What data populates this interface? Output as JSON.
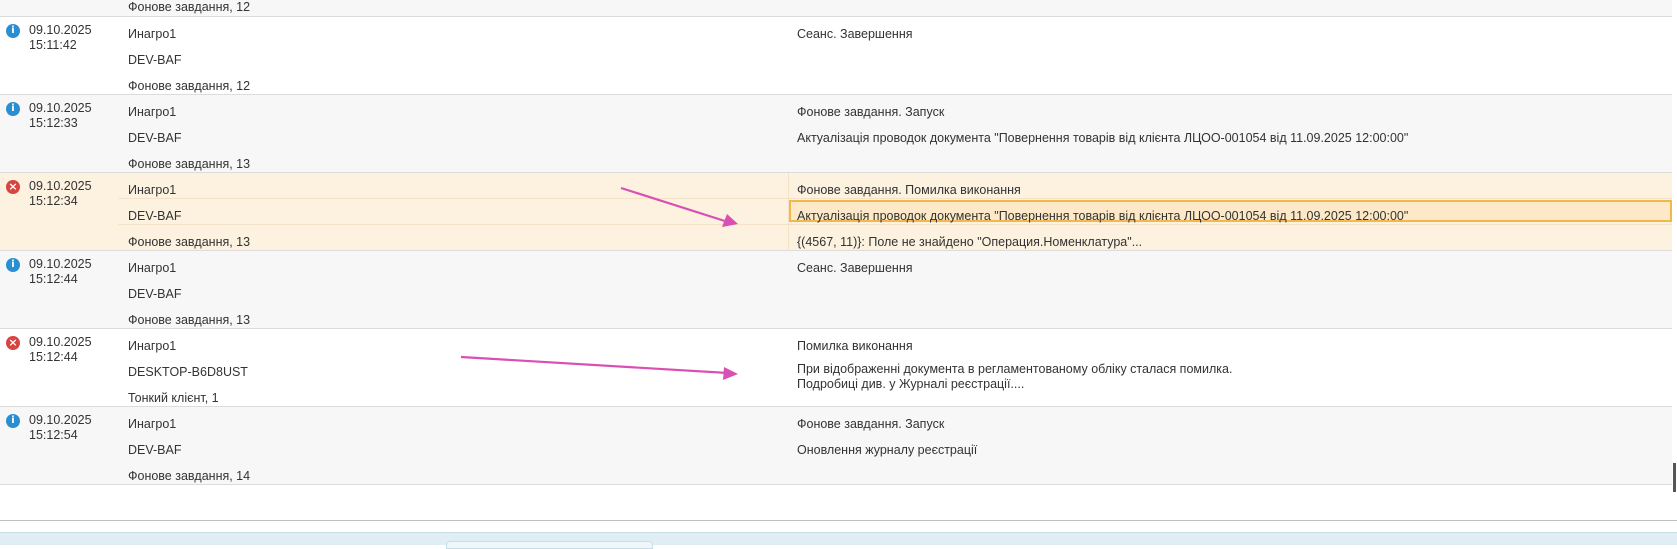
{
  "log": {
    "partial_row_text": "Фонове завдання, 12",
    "rows": [
      {
        "status": "info",
        "date": "09.10.2025",
        "time": "15:11:42",
        "user": "Инагро1",
        "computer": "DEV-BAF",
        "session": "Фонове завдання, 12",
        "event": "Сеанс. Завершення",
        "message": ""
      },
      {
        "status": "info",
        "date": "09.10.2025",
        "time": "15:12:33",
        "user": "Инагро1",
        "computer": "DEV-BAF",
        "session": "Фонове завдання, 13",
        "event": "Фонове завдання. Запуск",
        "message": "Актуалізація проводок документа \"Повернення товарів від клієнта ЛЦОО-001054 від 11.09.2025 12:00:00\""
      },
      {
        "status": "error",
        "date": "09.10.2025",
        "time": "15:12:34",
        "user": "Инагро1",
        "computer": "DEV-BAF",
        "session": "Фонове завдання, 13",
        "event": "Фонове завдання. Помилка виконання",
        "message": "Актуалізація проводок документа \"Повернення товарів від клієнта ЛЦОО-001054 від 11.09.2025 12:00:00\"",
        "comment": "{(4567, 11)}: Поле не знайдено \"Операция.Номенклатура\"..."
      },
      {
        "status": "info",
        "date": "09.10.2025",
        "time": "15:12:44",
        "user": "Инагро1",
        "computer": "DEV-BAF",
        "session": "Фонове завдання, 13",
        "event": "Сеанс. Завершення",
        "message": ""
      },
      {
        "status": "error",
        "date": "09.10.2025",
        "time": "15:12:44",
        "user": "Инагро1",
        "computer": "DESKTOP-B6D8UST",
        "session": "Тонкий клієнт, 1",
        "event": "Помилка виконання",
        "message_line1": "При відображенні документа в регламентованому обліку сталася помилка.",
        "message_line2": "Подробиці див. у Журналі реєстрації...."
      },
      {
        "status": "info",
        "date": "09.10.2025",
        "time": "15:12:54",
        "user": "Инагро1",
        "computer": "DEV-BAF",
        "session": "Фонове завдання, 14",
        "event": "Фонове завдання. Запуск",
        "message": "Оновлення журналу реєстрації"
      }
    ]
  },
  "icons": {
    "info": "i",
    "error": "×"
  },
  "colors": {
    "info_icon": "#2a8fd0",
    "error_icon": "#d64541",
    "selected_row": "#fdf1e0",
    "selected_cell_border": "#f2b84b",
    "annotation_arrow": "#d94fb4"
  }
}
